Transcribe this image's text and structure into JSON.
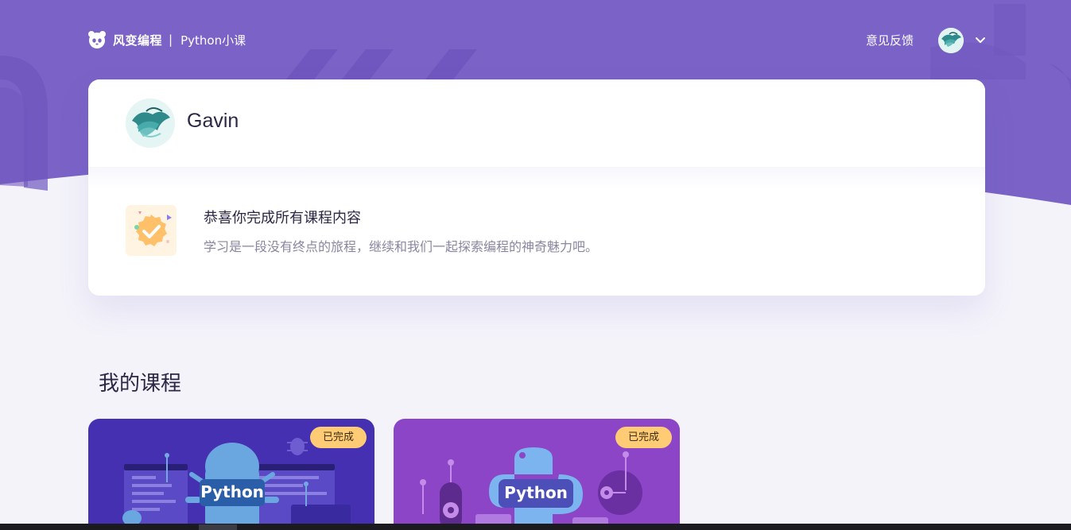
{
  "header": {
    "brand_name": "风变编程",
    "separator": "|",
    "course_name": "Python小课",
    "feedback_label": "意见反馈"
  },
  "profile": {
    "username": "Gavin"
  },
  "achievement": {
    "title": "恭喜你完成所有课程内容",
    "subtitle": "学习是一段没有终点的旅程，继续和我们一起探索编程的神奇魅力吧。"
  },
  "courses_section": {
    "title": "我的课程",
    "courses": [
      {
        "status": "已完成",
        "label": "Python",
        "theme_color": "#4430b0"
      },
      {
        "status": "已完成",
        "label": "Python",
        "theme_color": "#8b45c6"
      }
    ]
  },
  "colors": {
    "hero": "#7a62c6",
    "accent_tag": "#ffcc75",
    "text_dark": "#2b2745",
    "text_muted": "#8a86a0"
  },
  "icons": [
    "panda-logo-icon",
    "avatar-image",
    "chevron-down-icon",
    "completion-badge-icon",
    "python-robot-illustration",
    "python-logo-illustration"
  ]
}
